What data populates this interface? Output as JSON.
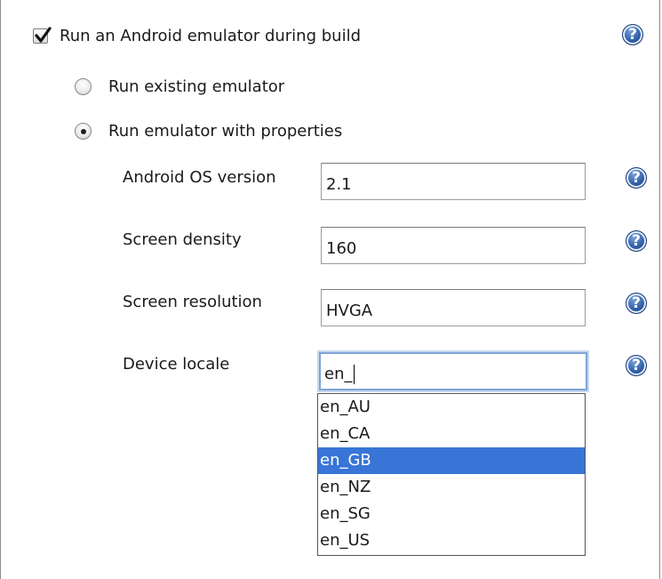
{
  "emulator": {
    "checkbox_label": "Run an Android emulator during build",
    "checked": true
  },
  "mode": {
    "existing_label": "Run existing emulator",
    "properties_label": "Run emulator with properties",
    "selected": "properties"
  },
  "properties": {
    "os_version": {
      "label": "Android OS version",
      "value": "2.1"
    },
    "density": {
      "label": "Screen density",
      "value": "160"
    },
    "resolution": {
      "label": "Screen resolution",
      "value": "HVGA"
    },
    "locale": {
      "label": "Device locale",
      "value": "en_"
    }
  },
  "help_glyph": "?",
  "help_icon": "help-question-circle",
  "locale_suggestions": [
    "en_AU",
    "en_CA",
    "en_GB",
    "en_NZ",
    "en_SG",
    "en_US"
  ],
  "highlighted_suggestion": "en_GB",
  "colors": {
    "selection": "#3875d7",
    "help_icon": "#2f5fa8",
    "focus_ring": "#7fa4d6"
  }
}
